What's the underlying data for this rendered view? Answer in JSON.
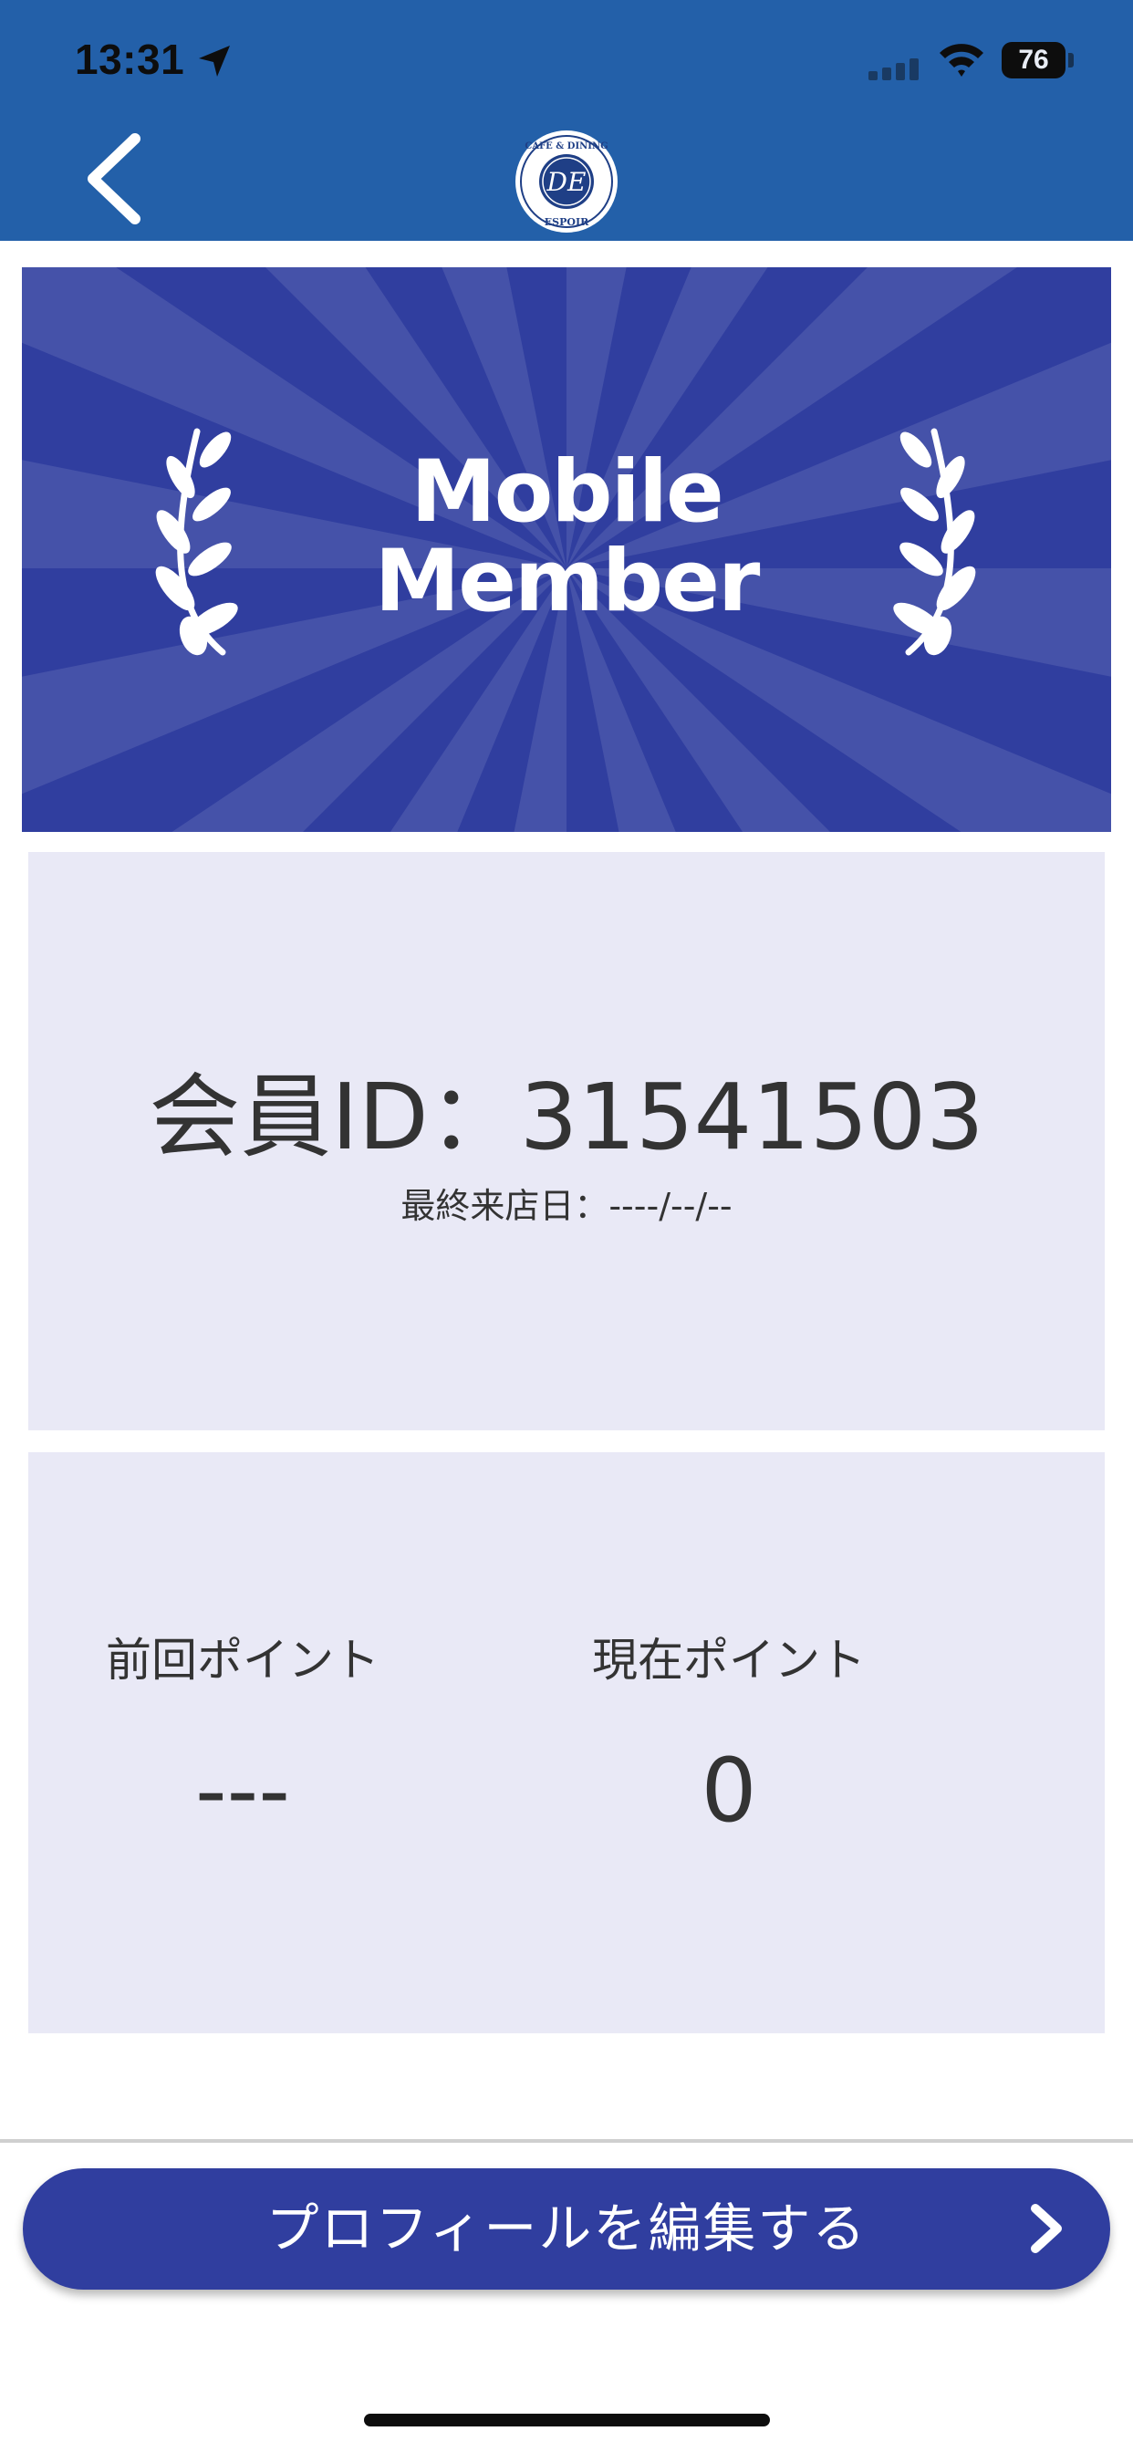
{
  "status_bar": {
    "time": "13:31",
    "battery": "76"
  },
  "header": {
    "logo_text_top": "CAFE & DINING",
    "logo_text_bottom": "ESPOIR",
    "logo_monogram": "DE"
  },
  "banner": {
    "line1": "Mobile",
    "line2": "Member"
  },
  "member_card": {
    "id_label": "会員ID：31541503",
    "last_visit": "最終来店日：----/--/--"
  },
  "points": {
    "previous_label": "前回ポイント",
    "previous_value": "---",
    "current_label": "現在ポイント",
    "current_value": "0"
  },
  "footer": {
    "edit_profile_label": "プロフィールを編集する"
  },
  "colors": {
    "header_blue": "#2360a9",
    "banner_navy": "#303e9f",
    "card_bg": "#e9e9f6"
  }
}
